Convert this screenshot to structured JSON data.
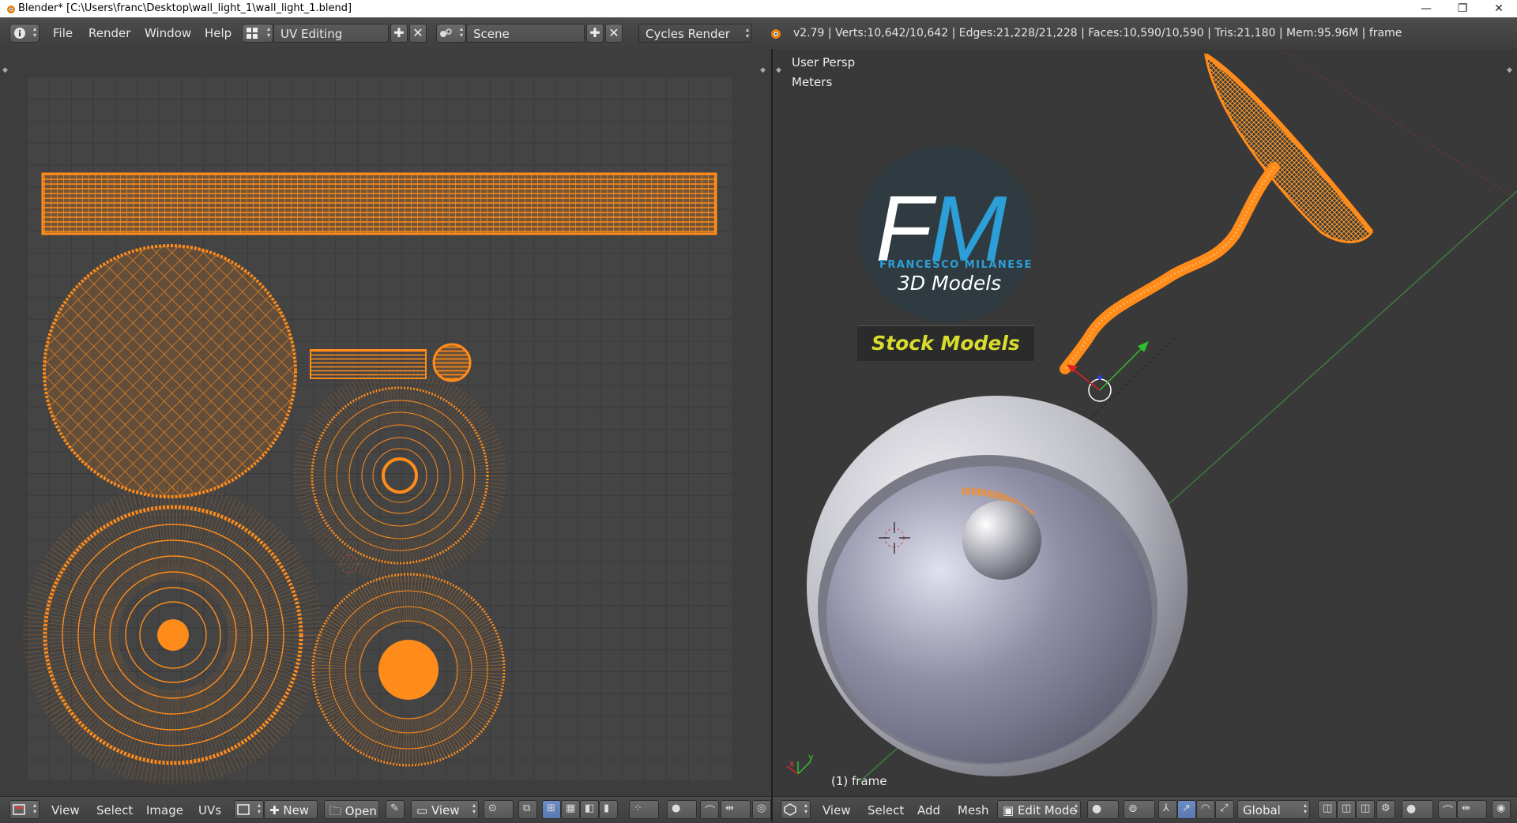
{
  "window": {
    "title": "Blender* [C:\\Users\\franc\\Desktop\\wall_light_1\\wall_light_1.blend]",
    "minimize_glyph": "—",
    "restore_glyph": "❐",
    "close_glyph": "✕"
  },
  "info_header": {
    "menu": [
      "File",
      "Render",
      "Window",
      "Help"
    ],
    "screen_layout": "UV Editing",
    "scene": "Scene",
    "render_engine": "Cycles Render",
    "stats": "v2.79 | Verts:10,642/10,642 | Edges:21,228/21,228 | Faces:10,590/10,590 | Tris:21,180 | Mem:95.96M | frame"
  },
  "viewport": {
    "view_name": "User Persp",
    "units": "Meters",
    "object_label": "(1) frame",
    "axis_x": "x",
    "axis_y": "y"
  },
  "logo": {
    "initials_f": "F",
    "initials_m": "M",
    "name": "FRANCESCO MILANESE",
    "subtitle": "3D Models",
    "banner": "Stock Models"
  },
  "uv_header": {
    "menu": [
      "View",
      "Select",
      "Image",
      "UVs"
    ],
    "new_label": "New",
    "open_label": "Open",
    "view_label": "View"
  },
  "view3d_header": {
    "menu": [
      "View",
      "Select",
      "Add",
      "Mesh"
    ],
    "mode": "Edit Mode",
    "orientation": "Global"
  },
  "colors": {
    "uv_orange": "#ff8c1a",
    "header_bg": "#474747",
    "viewport_bg": "#393939",
    "logo_blue": "#2d9fd8",
    "banner_yellow": "#d8dc2e"
  }
}
